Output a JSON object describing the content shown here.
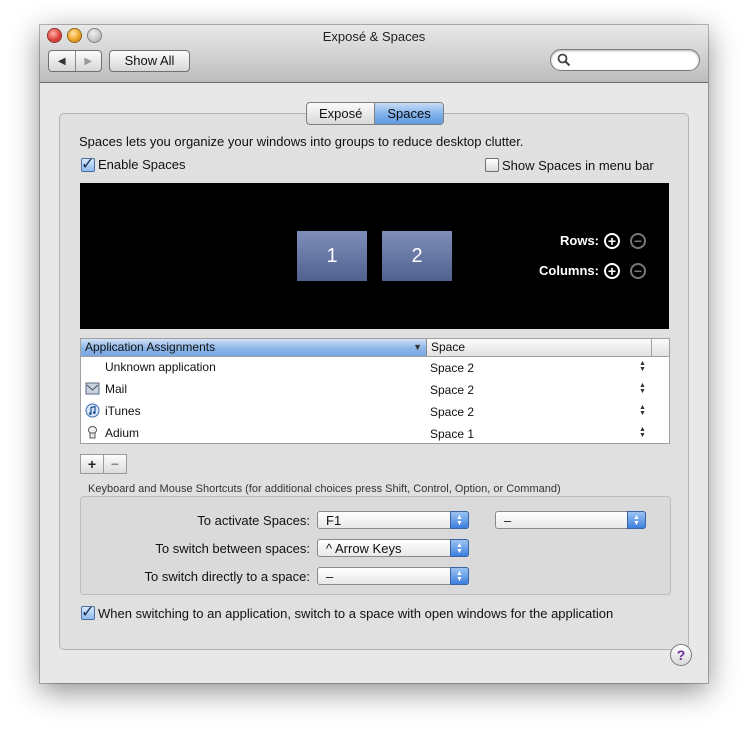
{
  "window": {
    "title": "Exposé & Spaces"
  },
  "toolbar": {
    "show_all": "Show All",
    "search_placeholder": ""
  },
  "tabs": [
    {
      "label": "Exposé",
      "selected": false
    },
    {
      "label": "Spaces",
      "selected": true
    }
  ],
  "description": "Spaces lets you organize your windows into groups to reduce desktop clutter.",
  "enable_spaces": {
    "label": "Enable Spaces",
    "checked": true
  },
  "show_in_menu_bar": {
    "label": "Show Spaces in menu bar",
    "checked": false
  },
  "preview": {
    "spaces": [
      "1",
      "2"
    ],
    "rows_label": "Rows:",
    "columns_label": "Columns:"
  },
  "assignments": {
    "columns": [
      "Application Assignments",
      "Space"
    ],
    "rows": [
      {
        "app": "Unknown application",
        "space": "Space 2",
        "icon": "none"
      },
      {
        "app": "Mail",
        "space": "Space 2",
        "icon": "mail-icon"
      },
      {
        "app": "iTunes",
        "space": "Space 2",
        "icon": "itunes-icon"
      },
      {
        "app": "Adium",
        "space": "Space 1",
        "icon": "adium-icon"
      }
    ]
  },
  "shortcuts": {
    "title": "Keyboard and Mouse Shortcuts (for additional choices press Shift, Control, Option, or Command)",
    "activate": {
      "label": "To activate Spaces:",
      "value": "F1",
      "secondary": "–"
    },
    "switch_between": {
      "label": "To switch between spaces:",
      "value": "^ Arrow Keys"
    },
    "switch_directly": {
      "label": "To switch directly to a space:",
      "value": "–"
    }
  },
  "switch_option": {
    "label": "When switching to an application, switch to a space with open windows for the application",
    "checked": true
  },
  "help_label": "?",
  "colors": {
    "tab_selected": "#7fb1ea",
    "preview_bg": "#000000",
    "space_tile": "#6677a3"
  }
}
